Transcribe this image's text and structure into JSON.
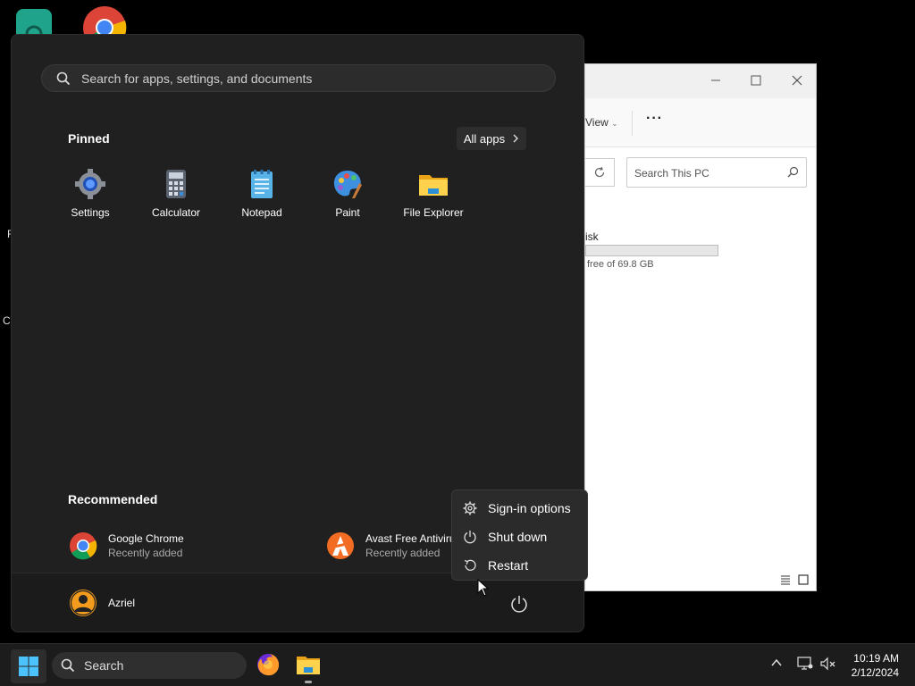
{
  "start_menu": {
    "search_placeholder": "Search for apps, settings, and documents",
    "pinned_title": "Pinned",
    "all_apps_label": "All apps",
    "pinned": [
      {
        "label": "Settings",
        "icon": "settings-gear-icon"
      },
      {
        "label": "Calculator",
        "icon": "calculator-icon"
      },
      {
        "label": "Notepad",
        "icon": "notepad-icon"
      },
      {
        "label": "Paint",
        "icon": "paint-palette-icon"
      },
      {
        "label": "File Explorer",
        "icon": "folder-icon"
      }
    ],
    "recommended_title": "Recommended",
    "recommended": [
      {
        "name": "Google Chrome",
        "sub": "Recently added",
        "icon": "chrome-icon"
      },
      {
        "name": "Avast Free Antiviru",
        "sub": "Recently added",
        "icon": "avast-icon"
      }
    ],
    "user_name": "Azriel"
  },
  "power_menu": {
    "items": [
      {
        "label": "Sign-in options",
        "icon": "gear-icon"
      },
      {
        "label": "Shut down",
        "icon": "power-icon"
      },
      {
        "label": "Restart",
        "icon": "restart-icon"
      }
    ]
  },
  "explorer": {
    "view_label": "View",
    "search_placeholder": "Search This PC",
    "disk_label": "isk",
    "disk_free": "free of 69.8 GB"
  },
  "desktop": {
    "frag_left_1": "F",
    "frag_left_2": "C"
  },
  "taskbar": {
    "search_label": "Search",
    "time": "10:19 AM",
    "date": "2/12/2024"
  },
  "colors": {
    "start_bg": "#202020",
    "accent": "#4cc2ff",
    "taskbar_bg": "#1c1c1c"
  }
}
